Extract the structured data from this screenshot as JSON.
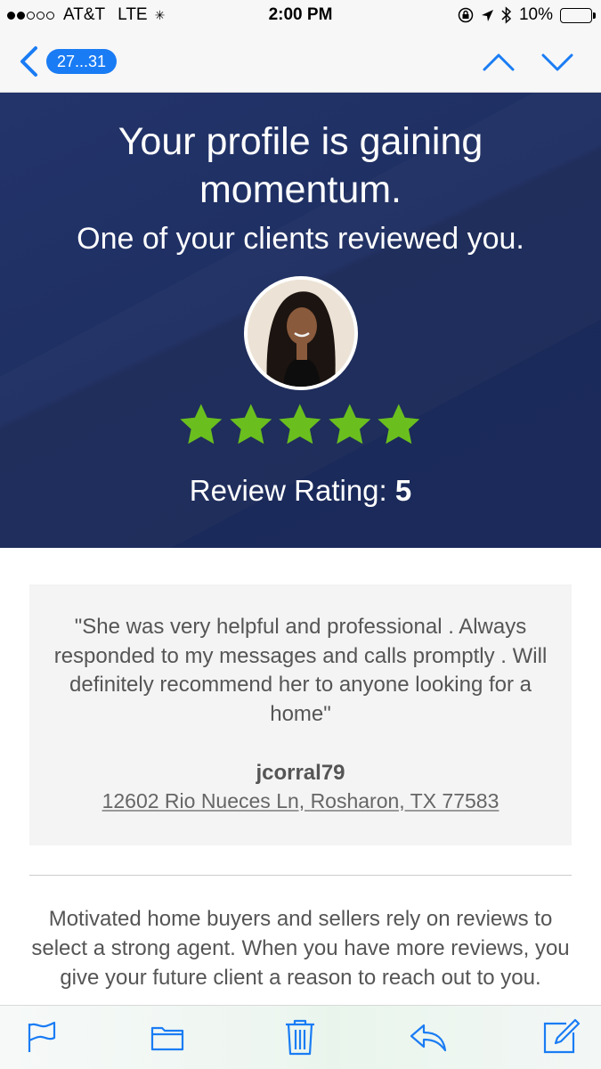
{
  "status_bar": {
    "carrier": "AT&T",
    "network": "LTE",
    "time": "2:00 PM",
    "battery": "10%"
  },
  "nav": {
    "badge": "27...31"
  },
  "hero": {
    "title": "Your profile is gaining momentum.",
    "subtitle": "One of your clients reviewed you.",
    "rating_label": "Review Rating:",
    "rating_value": "5",
    "stars": 5,
    "star_color": "#6abf1e"
  },
  "review": {
    "quote": "\"She was very helpful and professional . Always responded to my messages and calls promptly . Will definitely recommend her to anyone looking for a home\"",
    "reviewer": "jcorral79",
    "address": "12602 Rio Nueces Ln, Rosharon, TX 77583"
  },
  "body": {
    "text": "Motivated home buyers and sellers rely on reviews to select a strong agent. When you have more reviews, you give your future client a reason to reach out to you."
  },
  "toolbar": {
    "icons": [
      "flag-icon",
      "folder-icon",
      "trash-icon",
      "reply-icon",
      "compose-icon"
    ],
    "accent": "#1a7cf4"
  }
}
